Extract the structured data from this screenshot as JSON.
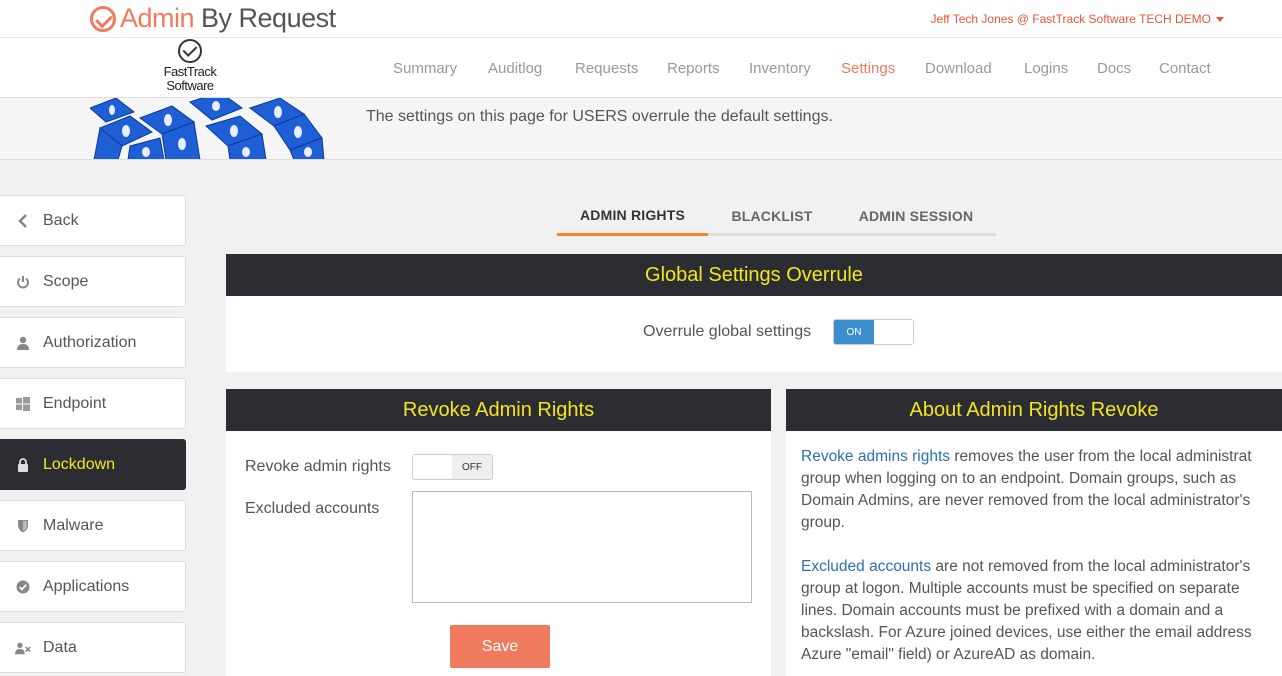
{
  "brand": {
    "name_part1": "Admin",
    "name_part2": "By Request"
  },
  "user_menu": {
    "label": "Jeff Tech Jones @ FastTrack Software TECH DEMO"
  },
  "company_logo": {
    "line1": "FastTrack",
    "line2": "Software"
  },
  "nav": {
    "items": [
      {
        "label": "Summary"
      },
      {
        "label": "Auditlog"
      },
      {
        "label": "Requests"
      },
      {
        "label": "Reports"
      },
      {
        "label": "Inventory"
      },
      {
        "label": "Settings",
        "active": true
      },
      {
        "label": "Download"
      },
      {
        "label": "Logins"
      },
      {
        "label": "Docs"
      },
      {
        "label": "Contact"
      }
    ]
  },
  "banner": {
    "text": "The settings on this page for USERS overrule the default settings."
  },
  "sidebar": {
    "items": [
      {
        "label": "Back",
        "icon": "chevron-left-icon"
      },
      {
        "label": "Scope",
        "icon": "power-icon"
      },
      {
        "label": "Authorization",
        "icon": "user-icon"
      },
      {
        "label": "Endpoint",
        "icon": "windows-icon"
      },
      {
        "label": "Lockdown",
        "icon": "lock-icon",
        "active": true
      },
      {
        "label": "Malware",
        "icon": "shield-icon"
      },
      {
        "label": "Applications",
        "icon": "check-circle-icon"
      },
      {
        "label": "Data",
        "icon": "user-remove-icon"
      }
    ]
  },
  "tabs": {
    "items": [
      {
        "label": "ADMIN RIGHTS",
        "active": true
      },
      {
        "label": "BLACKLIST"
      },
      {
        "label": "ADMIN SESSION"
      }
    ]
  },
  "global_overrule": {
    "title": "Global Settings Overrule",
    "label": "Overrule global settings",
    "toggle_on": "ON",
    "state": "on"
  },
  "revoke_panel": {
    "title": "Revoke Admin Rights",
    "revoke_label": "Revoke admin rights",
    "toggle_off": "OFF",
    "state": "off",
    "excluded_label": "Excluded accounts",
    "excluded_value": "",
    "save_label": "Save"
  },
  "about_panel": {
    "title": "About Admin Rights Revoke",
    "p1_highlight": "Revoke admins rights",
    "p1_line1": " removes the user from the local administrat",
    "p1_line2": "group when logging on to an endpoint. Domain groups, such as",
    "p1_line3": "Domain Admins, are never removed from the local administrator's",
    "p1_line4": "group.",
    "p2_highlight": "Excluded accounts",
    "p2_line1": " are not removed from the local administrator's",
    "p2_line2": "group at logon. Multiple accounts must be specified on separate",
    "p2_line3": "lines. Domain accounts must be prefixed with a domain and a",
    "p2_line4": "backslash. For Azure joined devices, use either the email address",
    "p2_line5": "Azure \"email\" field) or AzureAD as domain."
  },
  "colors": {
    "brand_accent": "#f07a5d",
    "panel_header_bg": "#2b2d33",
    "panel_header_text": "#f5e520",
    "toggle_on": "#3c8dcd",
    "tab_active_underline": "#f0882b",
    "link_highlight": "#2a6fb7"
  }
}
